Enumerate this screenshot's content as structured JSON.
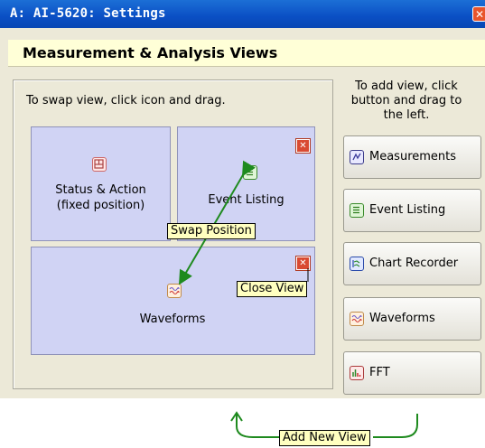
{
  "window": {
    "title": "A: AI-5620: Settings",
    "close_glyph": "✕"
  },
  "header": {
    "title": "Measurement & Analysis Views"
  },
  "panel": {
    "hint": "To swap view, click icon and drag.",
    "views": {
      "status": {
        "label_line1": "Status & Action",
        "label_line2": "(fixed position)",
        "icon": "status-icon"
      },
      "event": {
        "label": "Event Listing",
        "icon": "list-icon",
        "close_glyph": "✕"
      },
      "waveforms": {
        "label": "Waveforms",
        "icon": "waveform-icon",
        "close_glyph": "✕"
      }
    }
  },
  "sidebar": {
    "hint": "To add view, click button and drag to the left.",
    "buttons": [
      {
        "label": "Measurements",
        "icon": "measurements-icon"
      },
      {
        "label": "Event Listing",
        "icon": "list-icon"
      },
      {
        "label": "Chart Recorder",
        "icon": "chart-recorder-icon"
      },
      {
        "label": "Waveforms",
        "icon": "waveform-icon"
      },
      {
        "label": "FFT",
        "icon": "fft-icon"
      }
    ]
  },
  "callouts": {
    "swap": "Swap Position",
    "close": "Close View",
    "add": "Add New View"
  },
  "colors": {
    "titlebar": "#0a4fc4",
    "view_bg": "#d0d3f4",
    "callout_bg": "#ffffc0",
    "arrow": "#1e8a1e"
  }
}
